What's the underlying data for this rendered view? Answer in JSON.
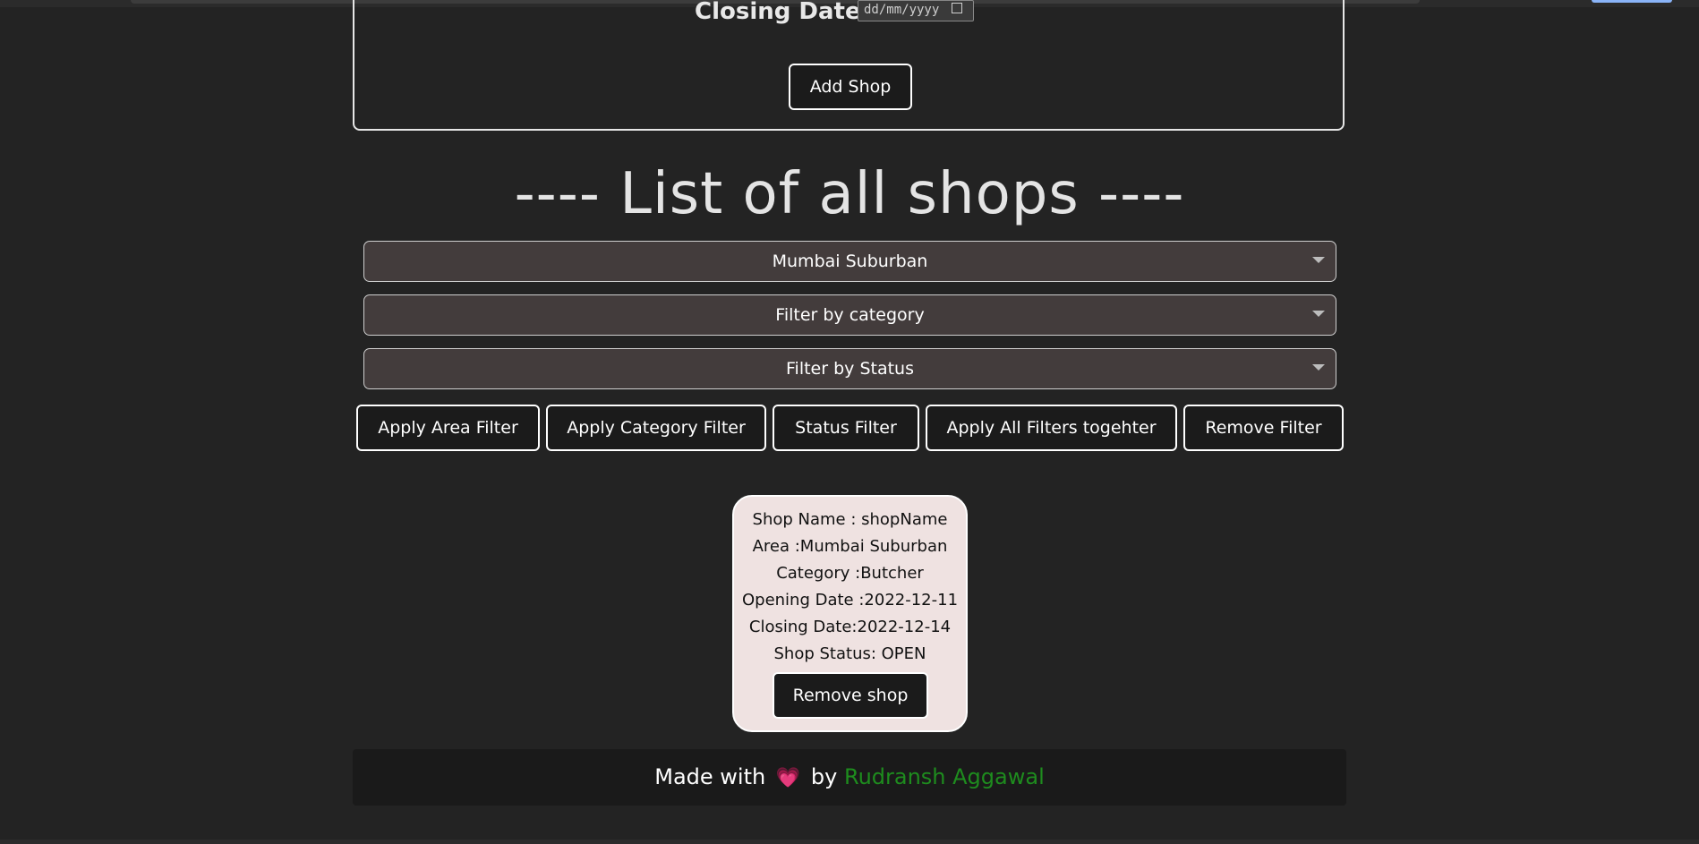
{
  "form": {
    "closing_date_label": "Closing Date :",
    "closing_date_placeholder": "dd/mm/yyyy",
    "add_shop_label": "Add Shop"
  },
  "list": {
    "title": "---- List of all shops ----",
    "area_select_value": "Mumbai Suburban",
    "category_select_value": "Filter by category",
    "status_select_value": "Filter by Status"
  },
  "filters": {
    "apply_area": "Apply Area Filter",
    "apply_category": "Apply Category Filter",
    "status": "Status Filter",
    "apply_all": "Apply All Filters togehter",
    "remove": "Remove Filter"
  },
  "shops": [
    {
      "name_line": "Shop Name : shopName",
      "area_line": "Area :Mumbai Suburban",
      "category_line": "Category :Butcher",
      "opening_line": "Opening Date :2022-12-11",
      "closing_line": "Closing Date:2022-12-14",
      "status_line": "Shop Status: OPEN",
      "remove_label": "Remove shop"
    }
  ],
  "footer": {
    "made_with": "Made with",
    "heart_icon": "heart-icon",
    "by": "by",
    "author": "Rudransh Aggawal",
    "author_color": "#1e8c1e",
    "heart_color": "#ff5aa5"
  },
  "colors": {
    "background": "#232323",
    "select_bg": "#433c3c",
    "card_bg": "#efe2e1",
    "button_bg": "#1b1b1b"
  }
}
